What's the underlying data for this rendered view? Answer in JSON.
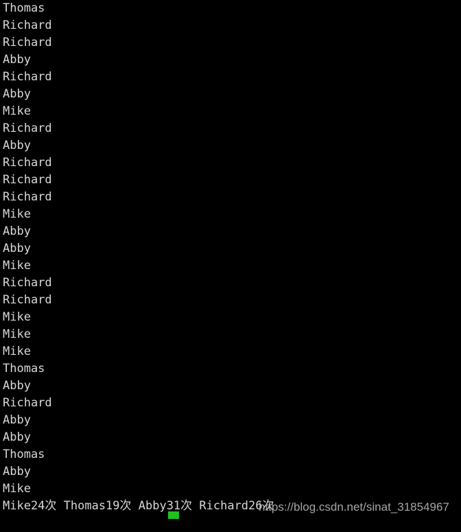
{
  "terminal": {
    "background_color": "#000000",
    "foreground_color": "#d8d8d8",
    "cursor_color": "#20c020",
    "output_lines": [
      "Thomas",
      "Richard",
      "Richard",
      "Abby",
      "Richard",
      "Abby",
      "Mike",
      "Richard",
      "Abby",
      "Richard",
      "Richard",
      "Richard",
      "Mike",
      "Abby",
      "Abby",
      "Mike",
      "Richard",
      "Richard",
      "Mike",
      "Mike",
      "Mike",
      "Thomas",
      "Abby",
      "Richard",
      "Abby",
      "Abby",
      "Thomas",
      "Abby",
      "Mike"
    ],
    "summary_line": "Mike24次 Thomas19次 Abby31次 Richard26次",
    "summary_counts": [
      {
        "name": "Mike",
        "count": 24,
        "unit": "次",
        "text": "Mike24次"
      },
      {
        "name": "Thomas",
        "count": 19,
        "unit": "次",
        "text": "Thomas19次"
      },
      {
        "name": "Abby",
        "count": 31,
        "unit": "次",
        "text": "Abby31次"
      },
      {
        "name": "Richard",
        "count": 26,
        "unit": "次",
        "text": "Richard26次"
      }
    ],
    "partial_bottom_line": "                              "
  },
  "watermark": {
    "text": "https://blog.csdn.net/sinat_31854967",
    "color": "#b4b4b4"
  }
}
